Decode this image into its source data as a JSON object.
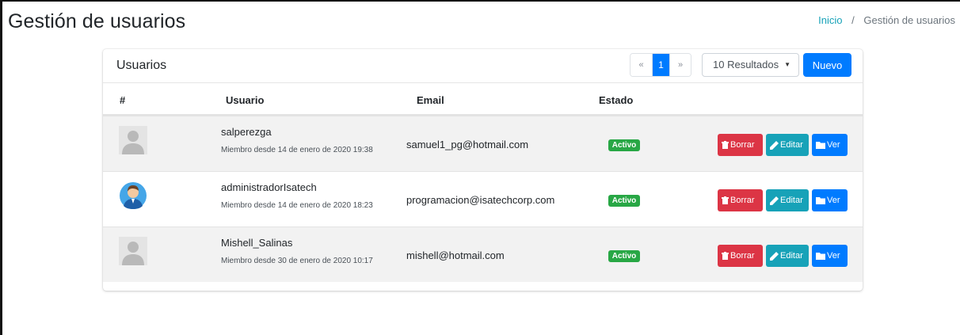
{
  "page": {
    "title": "Gestión de usuarios"
  },
  "breadcrumb": {
    "home": "Inicio",
    "separator": "/",
    "current": "Gestión de usuarios"
  },
  "card": {
    "title": "Usuarios",
    "pagination": {
      "prev": "«",
      "current": "1",
      "next": "»"
    },
    "results_select": "10 Resultados",
    "new_button": "Nuevo"
  },
  "table": {
    "headers": {
      "index": "#",
      "user": "Usuario",
      "email": "Email",
      "status": "Estado"
    },
    "rows": [
      {
        "username": "salperezga",
        "member_since": "Miembro desde 14 de enero de 2020 19:38",
        "email": "samuel1_pg@hotmail.com",
        "status": "Activo",
        "avatar": "default-avatar-icon"
      },
      {
        "username": "administradorIsatech",
        "member_since": "Miembro desde 14 de enero de 2020 18:23",
        "email": "programacion@isatechcorp.com",
        "status": "Activo",
        "avatar": "admin-avatar-icon"
      },
      {
        "username": "Mishell_Salinas",
        "member_since": "Miembro desde 30 de enero de 2020 10:17",
        "email": "mishell@hotmail.com",
        "status": "Activo",
        "avatar": "default-avatar-icon"
      }
    ]
  },
  "actions": {
    "delete": "Borrar",
    "edit": "Editar",
    "view": "Ver"
  },
  "colors": {
    "primary": "#007bff",
    "danger": "#dc3545",
    "info": "#17a2b8",
    "success": "#28a745"
  }
}
